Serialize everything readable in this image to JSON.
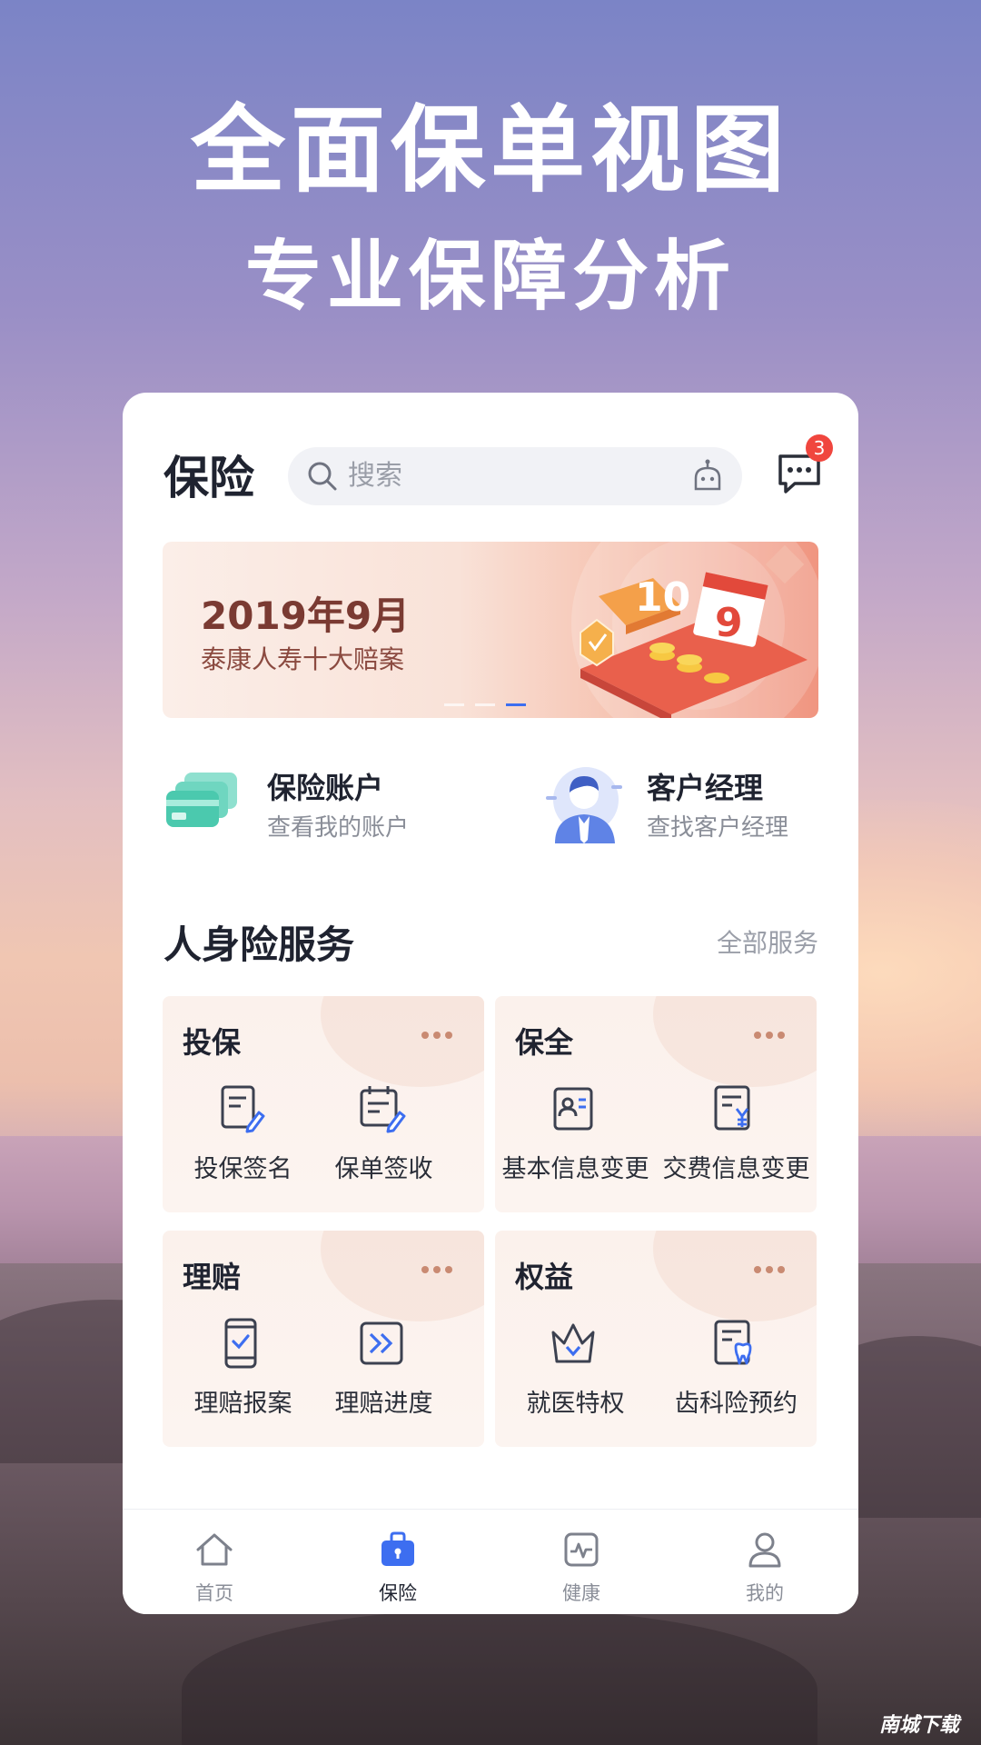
{
  "promo": {
    "headline": "全面保单视图",
    "subheadline": "专业保障分析"
  },
  "header": {
    "title": "保险",
    "search_placeholder": "搜索",
    "message_badge": "3"
  },
  "banner": {
    "title": "2019年9月",
    "subtitle": "泰康人寿十大赔案",
    "art_numbers": [
      "10",
      "9"
    ],
    "active_dot": 2
  },
  "quick_links": [
    {
      "title": "保险账户",
      "subtitle": "查看我的账户",
      "icon": "card-icon"
    },
    {
      "title": "客户经理",
      "subtitle": "查找客户经理",
      "icon": "manager-avatar-icon"
    }
  ],
  "section": {
    "title": "人身险服务",
    "link": "全部服务"
  },
  "services": [
    {
      "title": "投保",
      "items": [
        {
          "label": "投保签名",
          "icon": "document-pen-icon"
        },
        {
          "label": "保单签收",
          "icon": "calendar-pen-icon"
        }
      ]
    },
    {
      "title": "保全",
      "items": [
        {
          "label": "基本信息变更",
          "icon": "profile-card-icon"
        },
        {
          "label": "交费信息变更",
          "icon": "yuan-document-icon"
        }
      ]
    },
    {
      "title": "理赔",
      "items": [
        {
          "label": "理赔报案",
          "icon": "phone-check-icon"
        },
        {
          "label": "理赔进度",
          "icon": "progress-arrows-icon"
        }
      ]
    },
    {
      "title": "权益",
      "items": [
        {
          "label": "就医特权",
          "icon": "crown-icon"
        },
        {
          "label": "齿科险预约",
          "icon": "tooth-document-icon"
        }
      ]
    }
  ],
  "tabbar": [
    {
      "label": "首页",
      "icon": "home-icon",
      "active": false
    },
    {
      "label": "保险",
      "icon": "briefcase-icon",
      "active": true
    },
    {
      "label": "健康",
      "icon": "health-monitor-icon",
      "active": false
    },
    {
      "label": "我的",
      "icon": "person-icon",
      "active": false
    }
  ],
  "watermark": "南城下载",
  "colors": {
    "accent": "#3d6ef0",
    "title_text": "#1f2330",
    "muted_text": "#8a8e98",
    "badge": "#f0463e",
    "service_card_bg": "#fbf1ec",
    "icon_stroke": "#3c4150"
  }
}
